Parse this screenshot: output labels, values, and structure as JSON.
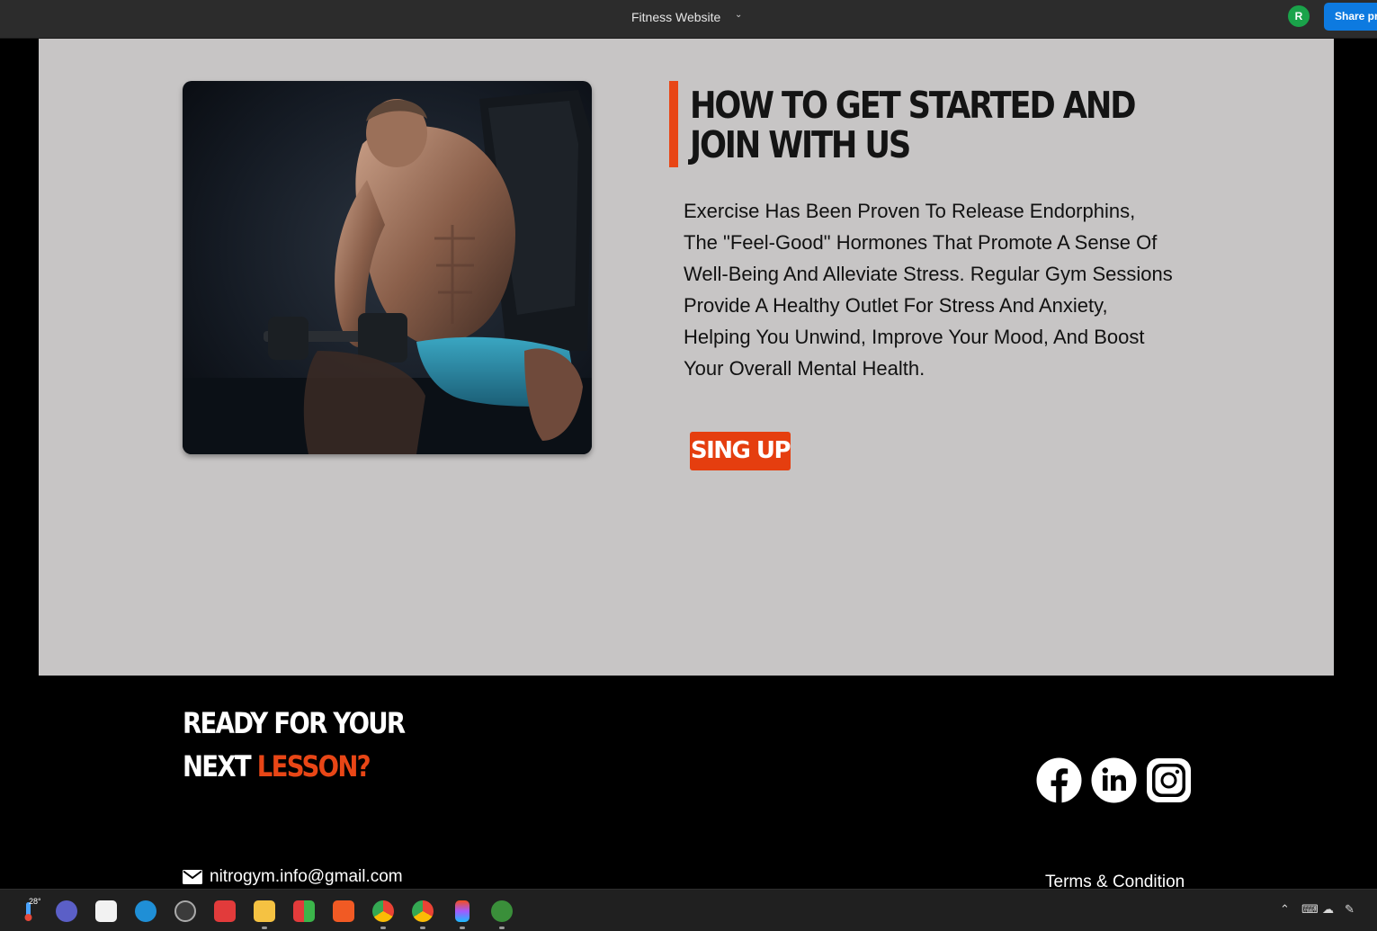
{
  "app": {
    "title": "Fitness Website",
    "user_initial": "R",
    "share_label": "Share pro"
  },
  "section": {
    "heading_line1": "HOW TO GET STARTED AND",
    "heading_line2": "JOIN WITH US",
    "body": "Exercise Has Been Proven To Release Endorphins, The \"Feel-Good\" Hormones That Promote A Sense Of Well-Being And Alleviate Stress. Regular Gym Sessions Provide A Healthy Outlet For Stress And Anxiety, Helping You Unwind, Improve Your Mood, And Boost Your Overall Mental Health.",
    "button_label": "SING UP",
    "image_icon": "athlete-photo"
  },
  "footer": {
    "heading_line1": "READY FOR YOUR",
    "heading_line2_part1": "NEXT ",
    "heading_line2_accent": "LESSON?",
    "email": "nitrogym.info@gmail.com",
    "terms": "Terms & Condition",
    "social": [
      "facebook-icon",
      "linkedin-icon",
      "instagram-icon"
    ]
  },
  "taskbar": {
    "temperature": "28°"
  },
  "colors": {
    "accent": "#e84616",
    "section_bg": "#c7c5c5",
    "footer_bg": "#000000",
    "share_button": "#0d7ae0"
  }
}
